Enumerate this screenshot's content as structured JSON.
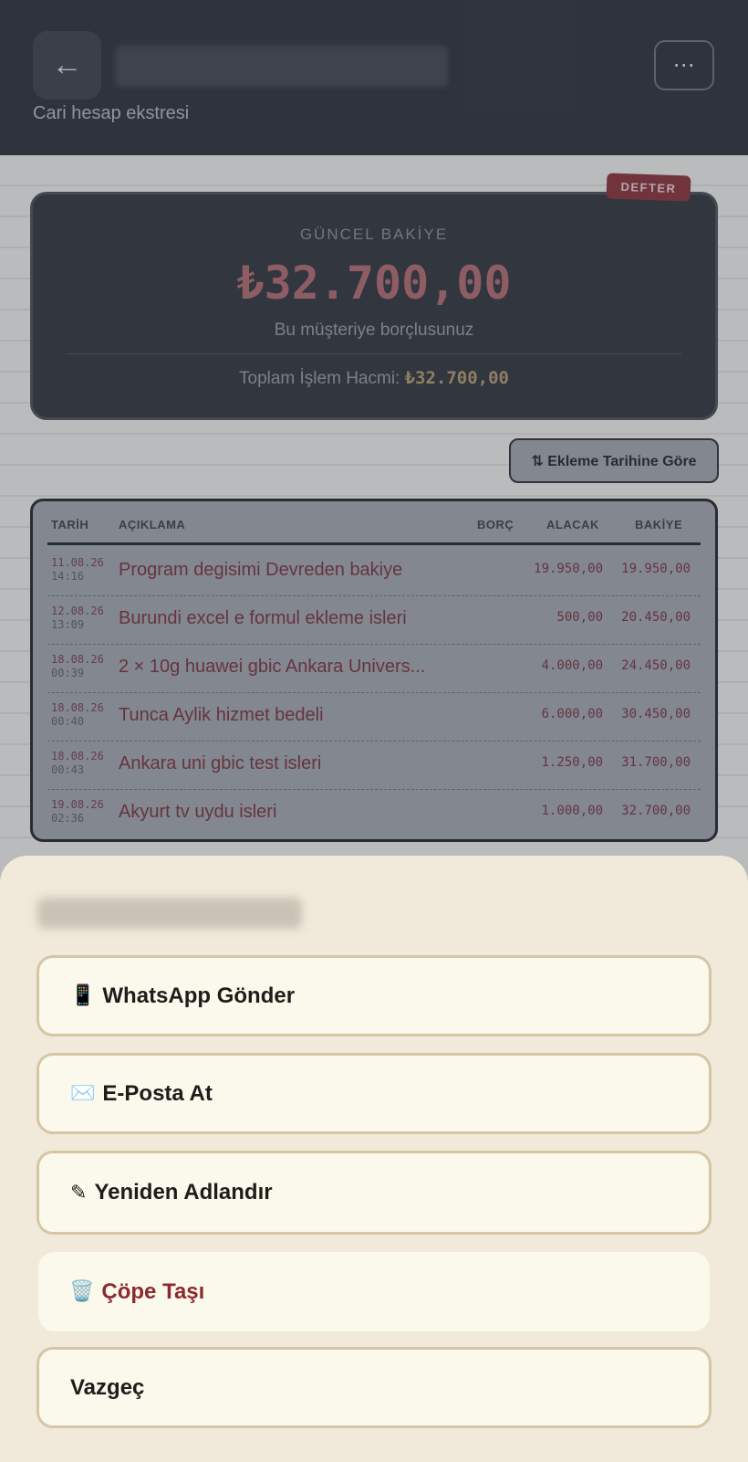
{
  "header": {
    "back_glyph": "←",
    "subtitle": "Cari hesap ekstresi",
    "more_glyph": "⋯"
  },
  "balance": {
    "tag": "DEFTER",
    "label": "GÜNCEL BAKİYE",
    "amount": "₺32.700,00",
    "note": "Bu müşteriye borçlusunuz",
    "volume_label": "Toplam İşlem Hacmi:",
    "volume_value": "₺32.700,00"
  },
  "sort": {
    "label": "⇅ Ekleme Tarihine Göre"
  },
  "table": {
    "headers": {
      "date": "TARİH",
      "desc": "AÇIKLAMA",
      "debit": "BORÇ",
      "credit": "ALACAK",
      "balance": "BAKİYE"
    },
    "rows": [
      {
        "date": "11.08.26",
        "time": "14:16",
        "desc": "Program degisimi Devreden bakiye",
        "debit": "",
        "credit": "19.950,00",
        "balance": "19.950,00"
      },
      {
        "date": "12.08.26",
        "time": "13:09",
        "desc": "Burundi excel e formul ekleme isleri",
        "debit": "",
        "credit": "500,00",
        "balance": "20.450,00"
      },
      {
        "date": "18.08.26",
        "time": "00:39",
        "desc": "2 × 10g huawei gbic Ankara Univers...",
        "debit": "",
        "credit": "4.000,00",
        "balance": "24.450,00"
      },
      {
        "date": "18.08.26",
        "time": "00:40",
        "desc": "Tunca Aylik hizmet bedeli",
        "debit": "",
        "credit": "6.000,00",
        "balance": "30.450,00"
      },
      {
        "date": "18.08.26",
        "time": "00:43",
        "desc": "Ankara uni gbic test isleri",
        "debit": "",
        "credit": "1.250,00",
        "balance": "31.700,00"
      },
      {
        "date": "19.08.26",
        "time": "02:36",
        "desc": "Akyurt tv uydu isleri",
        "debit": "",
        "credit": "1.000,00",
        "balance": "32.700,00"
      }
    ]
  },
  "sheet": {
    "actions": [
      {
        "icon": "📱",
        "label": "WhatsApp Gönder"
      },
      {
        "icon": "✉️",
        "label": "E-Posta At"
      },
      {
        "icon": "✎",
        "label": "Yeniden Adlandır"
      },
      {
        "icon": "🗑️",
        "label": "Çöpe Taşı"
      },
      {
        "icon": "",
        "label": "Vazgeç"
      }
    ]
  }
}
